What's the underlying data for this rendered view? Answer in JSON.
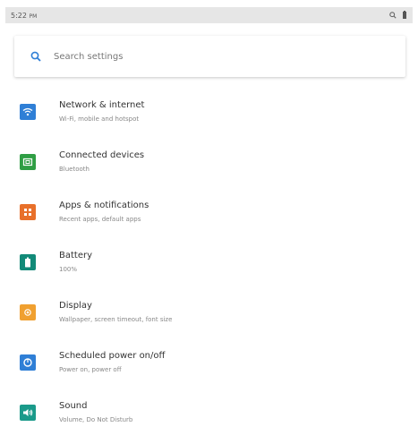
{
  "status_bar": {
    "time": "5:22",
    "ampm": "PM"
  },
  "search": {
    "placeholder": "Search settings"
  },
  "items": [
    {
      "title": "Network & internet",
      "summary": "Wi-Fi, mobile and hotspot",
      "icon": "wifi-icon",
      "color": "#2f7fd6"
    },
    {
      "title": "Connected devices",
      "summary": "Bluetooth",
      "icon": "devices-icon",
      "color": "#2f9e44"
    },
    {
      "title": "Apps & notifications",
      "summary": "Recent apps, default apps",
      "icon": "apps-icon",
      "color": "#e8702a"
    },
    {
      "title": "Battery",
      "summary": "100%",
      "icon": "battery-icon",
      "color": "#128a78"
    },
    {
      "title": "Display",
      "summary": "Wallpaper, screen timeout, font size",
      "icon": "display-icon",
      "color": "#f0a030"
    },
    {
      "title": "Scheduled power on/off",
      "summary": "Power on, power off",
      "icon": "power-schedule-icon",
      "color": "#2f7fd6"
    },
    {
      "title": "Sound",
      "summary": "Volume, Do Not Disturb",
      "icon": "sound-icon",
      "color": "#1a9a8a"
    }
  ]
}
